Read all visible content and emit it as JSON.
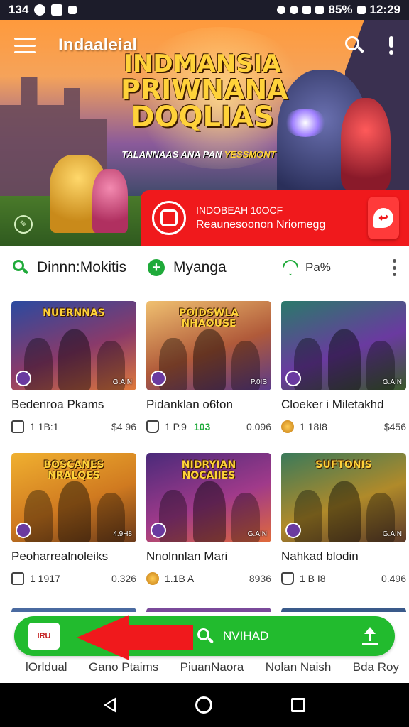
{
  "status_bar": {
    "time_left": "134",
    "battery": "85%",
    "time_right": "12:29"
  },
  "app_bar": {
    "title": "Indaaleial",
    "icons": [
      "menu-icon",
      "search-icon",
      "info-icon"
    ]
  },
  "hero": {
    "title_lines": [
      "INDMANSIA",
      "PRIWNANA",
      "DOQLIAS"
    ],
    "subtitle_a": "TALANNAAS ANA PAN ",
    "subtitle_b": "YESSMONT"
  },
  "promo": {
    "line1": "INDOBEAH 10OCF",
    "line2": "Reaunesoonon Nriomegg"
  },
  "filters": [
    {
      "label": "Dinnn:Mokitis",
      "icon": "search-icon"
    },
    {
      "label": "Myanga",
      "icon": "plus-icon"
    },
    {
      "label": "Pa%",
      "icon": "heart-icon"
    }
  ],
  "cards": [
    {
      "title": "Bedenroa Pkams",
      "banner": "NUERNNAS",
      "meta": "1 1B:1",
      "extra": "",
      "price": "$4 96",
      "tag": "G.AIN",
      "icon": "bookmark-icon",
      "colors": [
        "#2a4aa0",
        "#8a3a6a",
        "#e07a3a"
      ]
    },
    {
      "title": "Pidanklan o6ton",
      "banner": "POIDSWLA\nNHAOUSE",
      "meta": "1 P.9",
      "extra": "103",
      "price": "0.096",
      "tag": "P.0IS",
      "icon": "bag-icon",
      "colors": [
        "#f0c070",
        "#b05a3a",
        "#5a3a8a"
      ]
    },
    {
      "title": "Cloeker i Miletakhd",
      "banner": "",
      "meta": "1 18I8",
      "extra": "",
      "price": "$456",
      "tag": "G.AIN",
      "icon": "coin-icon",
      "colors": [
        "#2a7a6a",
        "#6a3aa0",
        "#3a5a2a"
      ]
    },
    {
      "title": "Peoharrealnoleiks",
      "banner": "BOSCANES\nNRALQES",
      "meta": "1 1917",
      "extra": "",
      "price": "0.326",
      "tag": "4.9H8",
      "icon": "bookmark-icon",
      "colors": [
        "#f0b030",
        "#d07a20",
        "#6a3a1a"
      ]
    },
    {
      "title": "Nnolnnlan Mari",
      "banner": "NIDRYIAN\nNOCAIIES",
      "meta": "1.1B A",
      "extra": "",
      "price": "8936",
      "tag": "G.AIN",
      "icon": "coin-icon",
      "colors": [
        "#4a2a7a",
        "#a03a8a",
        "#e06a3a"
      ]
    },
    {
      "title": "Nahkad blodin",
      "banner": "SUFTONIS",
      "meta": "1 B I8",
      "extra": "",
      "price": "0.496",
      "tag": "G.AIN",
      "icon": "bag-icon",
      "colors": [
        "#3a7a5a",
        "#b08a2a",
        "#5a3a2a"
      ]
    }
  ],
  "action_bar": {
    "home_label": "IRU",
    "search_label": "NVIHAD"
  },
  "bottom_tabs": [
    "lOrldual",
    "Gano Ptaims",
    "PiuanNaora",
    "Nolan Naish",
    "Bda Roy"
  ],
  "colors": {
    "accent_green": "#22bb2e",
    "promo_red": "#f0191c",
    "arrow_red": "#f0191c"
  }
}
